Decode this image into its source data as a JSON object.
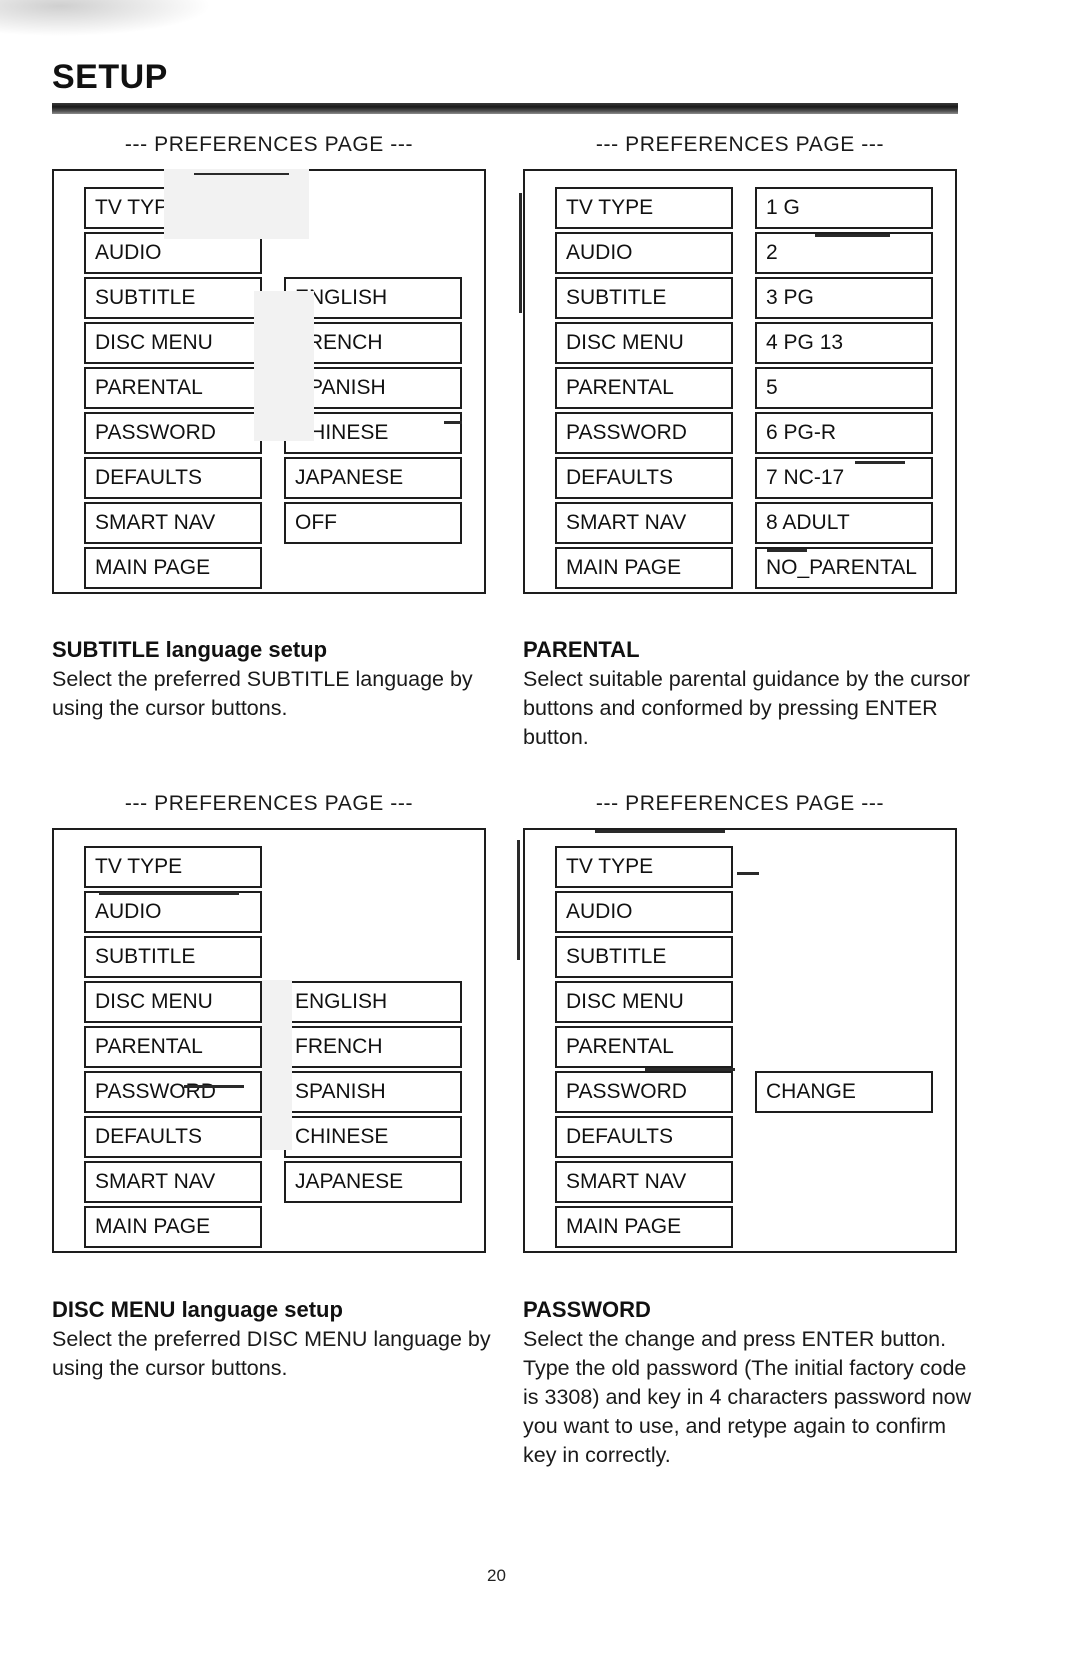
{
  "document": {
    "section_title": "SETUP",
    "page_number": "20"
  },
  "figures": [
    {
      "id": "subtitle-language",
      "osd_header": "--- PREFERENCES PAGE ---",
      "menu_items": [
        "TV TYPE",
        "AUDIO",
        "SUBTITLE",
        "DISC MENU",
        "PARENTAL",
        "PASSWORD",
        "DEFAULTS",
        "SMART NAV",
        "MAIN PAGE"
      ],
      "option_values": [
        "",
        "",
        "ENGLISH",
        "FRENCH",
        "SPANISH",
        "CHINESE",
        "JAPANESE",
        "OFF",
        ""
      ],
      "caption_title_bold": "SUBTITLE",
      "caption_title_rest": " language setup",
      "caption_body": "Select the preferred SUBTITLE language by using the cursor buttons."
    },
    {
      "id": "parental",
      "osd_header": "--- PREFERENCES PAGE ---",
      "menu_items": [
        "TV TYPE",
        "AUDIO",
        "SUBTITLE",
        "DISC MENU",
        "PARENTAL",
        "PASSWORD",
        "DEFAULTS",
        "SMART NAV",
        "MAIN PAGE"
      ],
      "option_values": [
        "1 G",
        "2",
        "3 PG",
        "4 PG 13",
        "5",
        "6 PG-R",
        "7 NC-17",
        "8 ADULT",
        "NO_PARENTAL"
      ],
      "caption_title_bold": "PARENTAL",
      "caption_title_rest": "",
      "caption_body": "Select suitable parental guidance by the cursor buttons and conformed by pressing ENTER button."
    },
    {
      "id": "disc-menu-language",
      "osd_header": "--- PREFERENCES PAGE ---",
      "menu_items": [
        "TV TYPE",
        "AUDIO",
        "SUBTITLE",
        "DISC MENU",
        "PARENTAL",
        "PASSWORD",
        "DEFAULTS",
        "SMART NAV",
        "MAIN PAGE"
      ],
      "option_values": [
        "",
        "",
        "",
        "ENGLISH",
        "FRENCH",
        "SPANISH",
        "CHINESE",
        "JAPANESE",
        ""
      ],
      "caption_title_bold": "DISC MENU",
      "caption_title_rest": " language setup",
      "caption_body": "Select the preferred DISC MENU language by using the cursor buttons."
    },
    {
      "id": "password",
      "osd_header": "--- PREFERENCES PAGE ---",
      "menu_items": [
        "TV TYPE",
        "AUDIO",
        "SUBTITLE",
        "DISC MENU",
        "PARENTAL",
        "PASSWORD",
        "DEFAULTS",
        "SMART NAV",
        "MAIN PAGE"
      ],
      "option_values": [
        "",
        "",
        "",
        "",
        "",
        "CHANGE",
        "",
        "",
        ""
      ],
      "caption_title_bold": "PASSWORD",
      "caption_title_rest": "",
      "caption_body": "Select the change and press ENTER button.  Type the old password (The initial factory code is 3308) and key in 4 characters password now you want to use, and retype again to confirm key in correctly."
    }
  ]
}
